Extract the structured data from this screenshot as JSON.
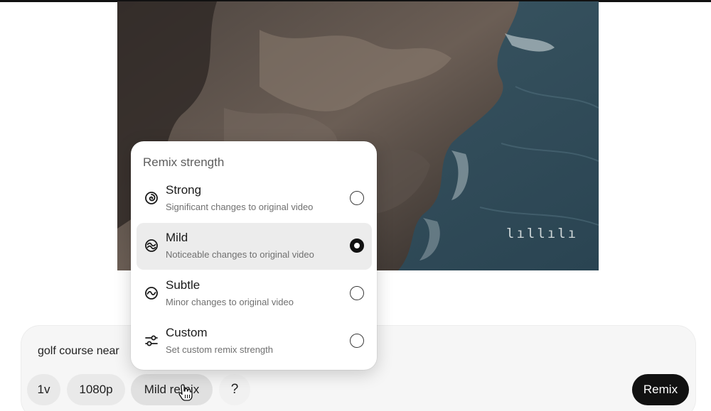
{
  "remix_popover": {
    "title": "Remix strength",
    "options": [
      {
        "label": "Strong",
        "description": "Significant changes to original video",
        "selected": false,
        "icon": "spiral-icon"
      },
      {
        "label": "Mild",
        "description": "Noticeable changes to original video",
        "selected": true,
        "icon": "double-wave-icon"
      },
      {
        "label": "Subtle",
        "description": "Minor changes to original video",
        "selected": false,
        "icon": "single-wave-icon"
      },
      {
        "label": "Custom",
        "description": "Set custom remix strength",
        "selected": false,
        "icon": "sliders-icon"
      }
    ]
  },
  "composer": {
    "prompt_text": "golf course near",
    "chips": {
      "version": "1v",
      "resolution": "1080p",
      "remix_strength": "Mild remix",
      "help": "?"
    },
    "submit_label": "Remix"
  },
  "video": {
    "watermark": "lıllılı"
  },
  "colors": {
    "primary_button": "#111111",
    "chip_background": "#e9e9e9",
    "selected_option": "#ececec"
  }
}
